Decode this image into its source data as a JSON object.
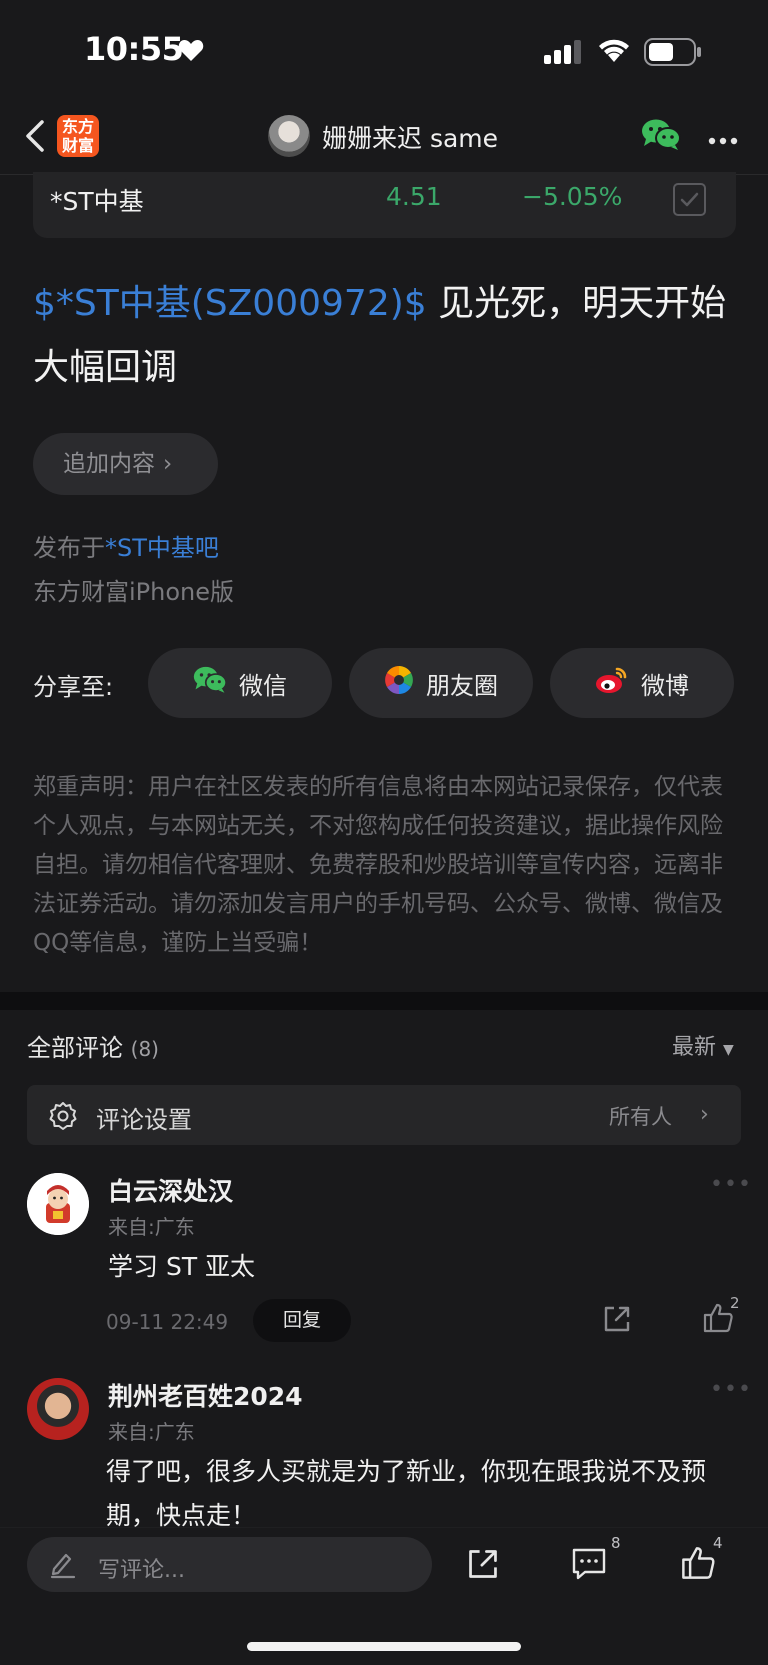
{
  "status_bar": {
    "time": "10:55"
  },
  "nav": {
    "logo_line1": "东方",
    "logo_line2": "财富",
    "author_name": "姗姗来迟 same"
  },
  "stock": {
    "name": "*ST中基",
    "price": "4.51",
    "change": "−5.05%",
    "color": "#3ba86a"
  },
  "post": {
    "stock_tag": "$*ST中基(SZ000972)$",
    "text": " 见光死，明天开始大幅回调",
    "append_label": "追加内容",
    "published_prefix": "发布于",
    "published_forum": "*ST中基吧",
    "client": "东方财富iPhone版"
  },
  "share": {
    "label": "分享至:",
    "wechat": "微信",
    "moments": "朋友圈",
    "weibo": "微博"
  },
  "disclaimer": "郑重声明：用户在社区发表的所有信息将由本网站记录保存，仅代表个人观点，与本网站无关，不对您构成任何投资建议，据此操作风险自担。请勿相信代客理财、免费荐股和炒股培训等宣传内容，远离非法证券活动。请勿添加发言用户的手机号码、公众号、微博、微信及QQ等信息，谨防上当受骗！",
  "comments_section": {
    "title": "全部评论",
    "count": "(8)",
    "sort": "最新",
    "settings_label": "评论设置",
    "settings_value": "所有人"
  },
  "comments": [
    {
      "name": "白云深处汉",
      "from": "来自:广东",
      "text": "学习 ST 亚太",
      "time": "09-11 22:49",
      "reply": "回复",
      "likes": "2"
    },
    {
      "name": "荆州老百姓2024",
      "from": "来自:广东",
      "text": "得了吧，很多人买就是为了新业，你现在跟我说不及预期，快点走！"
    }
  ],
  "bottom_bar": {
    "placeholder": "写评论...",
    "comment_count": "8",
    "like_count": "4"
  },
  "colors": {
    "accent_link": "#3a7fd6",
    "brand": "#f5561f",
    "down_green": "#3ba86a",
    "background": "#19191b"
  },
  "icons": [
    "heart-icon",
    "signal-icon",
    "wifi-icon",
    "battery-icon",
    "back-icon",
    "wechat-icon",
    "more-icon",
    "checkbox-icon",
    "chevron-right-icon",
    "moments-icon",
    "weibo-icon",
    "gear-icon",
    "share-icon",
    "thumbs-up-icon",
    "pen-icon",
    "comment-icon"
  ]
}
